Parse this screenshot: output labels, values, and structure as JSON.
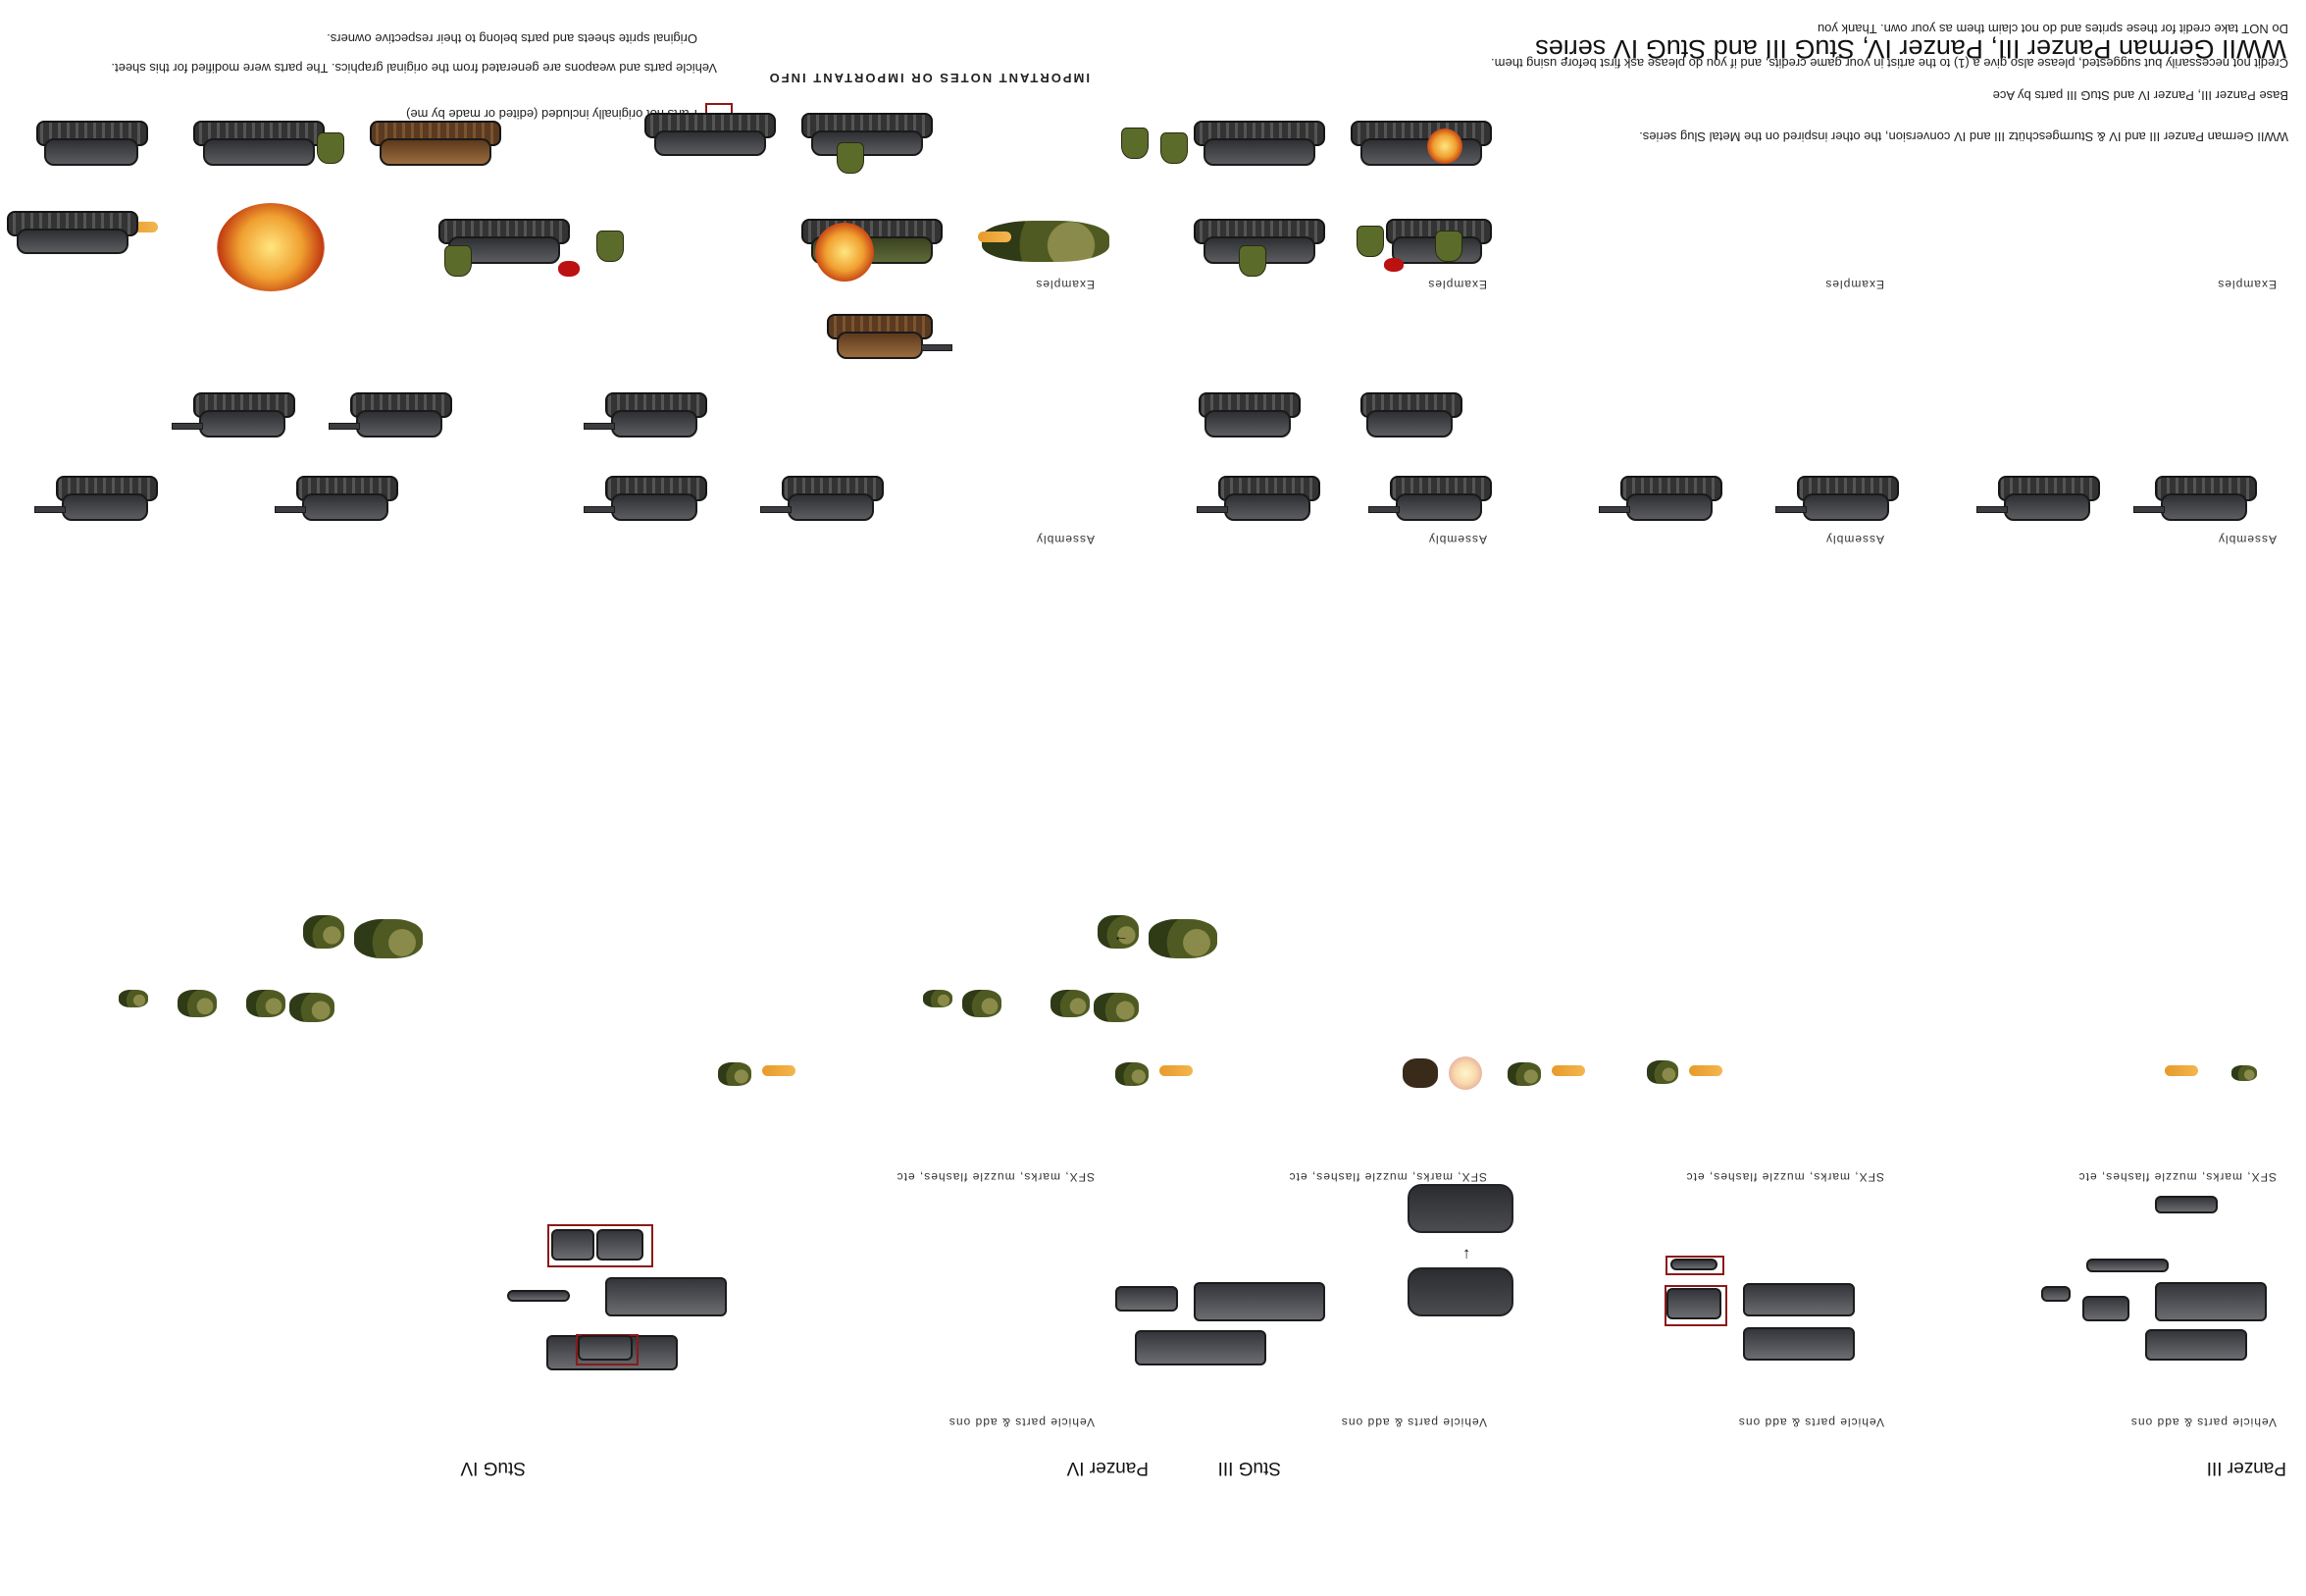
{
  "sheet": {
    "title": "WWII German Panzer III, Panzer IV, StuG III and StuG IV series",
    "intro_lines": [
      "WWII German Panzer III and IV & Sturmgeschütz III and IV conversion, the other inspired on the Metal Slug series.",
      "Base Panzer III, Panzer IV and StuG III parts by Ace",
      "Credit not necessarily but suggested, please also give a (1) to the artist in your game credits, and if you do please ask first before using them.",
      "Do NOT take credit for these sprites and do not claim them as your own. Thank you"
    ],
    "important_title": "IMPORTANT NOTES OR IMPORTANT INFO",
    "important_lines": [
      "Vehicle parts and weapons are generated from the original graphics. The parts were modified for this sheet.",
      "Original sprite sheets and parts belong to their respective owners."
    ],
    "legend_text": "Parts not originally included (edited or made by me)"
  },
  "columns": [
    {
      "name": "Panzer III",
      "parts_label": "Vehicle parts & add ons",
      "fx_label": "SFX, marks, muzzle flashes, etc",
      "assembly_label": "Assembly",
      "examples_label": "Examples"
    },
    {
      "name": "StuG III",
      "parts_label": "Vehicle parts & add ons",
      "fx_label": "SFX, marks, muzzle flashes, etc",
      "assembly_label": "Assembly",
      "examples_label": "Examples"
    },
    {
      "name": "Panzer IV",
      "parts_label": "Vehicle parts & add ons",
      "fx_label": "SFX, marks, muzzle flashes, etc",
      "assembly_label": "Assembly",
      "examples_label": "Examples"
    },
    {
      "name": "StuG IV",
      "parts_label": "Vehicle parts & add ons",
      "fx_label": "SFX, marks, muzzle flashes, etc",
      "assembly_label": "Assembly",
      "examples_label": "Examples"
    }
  ],
  "colors": {
    "background": "#ffffff",
    "highlight_box": "#8b1a1a",
    "tank_grey": "#3b3d40",
    "camo_green": "#4f5a22",
    "fire_orange": "#f0a030",
    "rust_brown": "#7c5430"
  }
}
